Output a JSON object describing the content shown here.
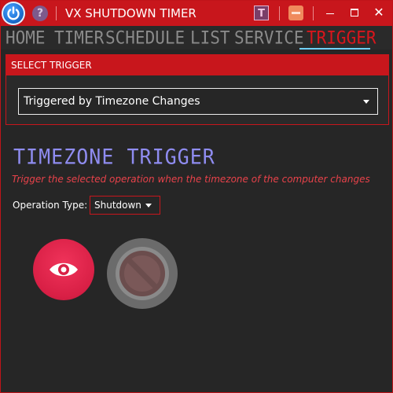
{
  "app": {
    "title": "VX SHUTDOWN TIMER",
    "help_glyph": "?",
    "trigger_icon_glyph": "T",
    "close_glyph": "✕"
  },
  "nav": {
    "items": [
      {
        "label": "HOME"
      },
      {
        "label": "TIMER"
      },
      {
        "label": "SCHEDULE"
      },
      {
        "label": "LIST"
      },
      {
        "label": "SERVICE"
      },
      {
        "label": "TRIGGER"
      }
    ],
    "active": "TRIGGER"
  },
  "select_trigger": {
    "header": "SELECT TRIGGER",
    "selected_value": "Triggered by Timezone Changes"
  },
  "trigger_section": {
    "title": "TIMEZONE TRIGGER",
    "description": "Trigger the selected operation when the timezone of the computer changes",
    "operation_label": "Operation Type:",
    "operation_value": "Shutdown"
  },
  "colors": {
    "accent_red": "#c8161c",
    "title_purple": "#8f8cf0",
    "desc_red": "#e8424a",
    "active_underline": "#6fd0ff",
    "start_button": "#d81f45",
    "disabled_button": "#6b6b6b"
  },
  "icons": {
    "app": "power-icon",
    "help": "help-icon",
    "trigger": "trigger-icon",
    "tray": "minimize-to-tray-icon",
    "start": "eye-icon",
    "cancel": "no-entry-icon"
  }
}
